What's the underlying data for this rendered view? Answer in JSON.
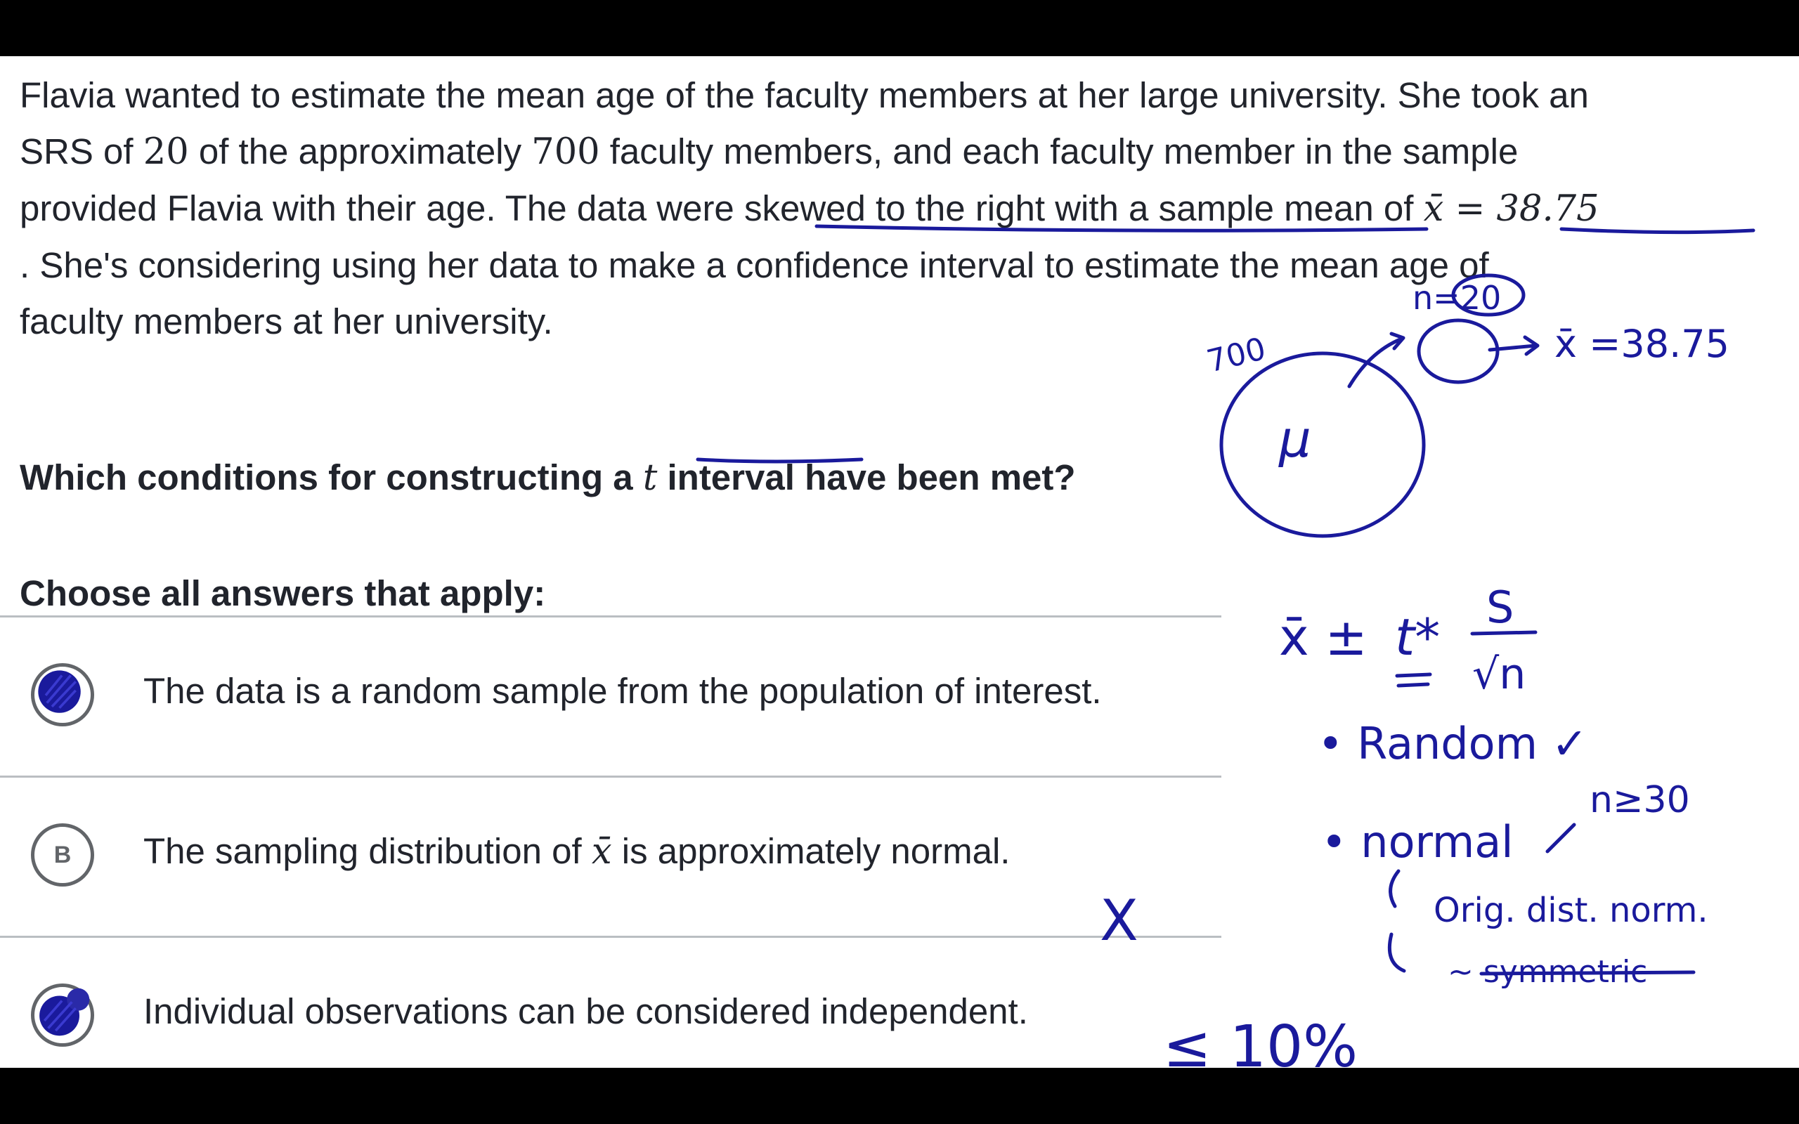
{
  "passage": {
    "line1": "Flavia wanted to estimate the mean age of the faculty members at her large university. She took an",
    "line2_a": "SRS of ",
    "line2_n": "20",
    "line2_b": " of the approximately ",
    "line2_N": "700",
    "line2_c": " faculty members, and each faculty member in the sample",
    "line3_a": "provided Flavia with their age. The data were skewed to the right with a sample mean of ",
    "line3_math": "x̄ = 38.75",
    "line4": ". She's considering using her data to make a confidence interval to estimate the mean age of",
    "line5": "faculty members at her university."
  },
  "question": {
    "before": "Which conditions for constructing a ",
    "t": "t",
    "after": " interval have been met?"
  },
  "instruction": "Choose all answers that apply:",
  "choices": [
    {
      "letter": "A",
      "text_a": "The data is a random sample from the population of interest.",
      "selected": true
    },
    {
      "letter": "B",
      "text_a": "The sampling distribution of ",
      "math": "x̄",
      "text_b": " is approximately normal.",
      "selected": false
    },
    {
      "letter": "C",
      "text_a": "Individual observations can be considered independent.",
      "selected": true
    }
  ],
  "annotations": {
    "population_size": "700",
    "sample_size": "n=20",
    "xbar_value": "x̄ =38.75",
    "mu": "μ",
    "formula_xbar": "x̄ ±",
    "formula_t": "t*",
    "formula_s": "S",
    "formula_sqrt": "√n",
    "random": "• Random ✓",
    "normal": "• normal",
    "n30": "n≥30",
    "orig": "Orig. dist. norm.",
    "symmetric": "~ symmetric",
    "ten_percent": "≤ 10%",
    "x_mark": "X"
  },
  "colors": {
    "ink": "#1a1a9c",
    "text": "#21242c",
    "divider": "#babec2",
    "bubble": "#626569"
  }
}
